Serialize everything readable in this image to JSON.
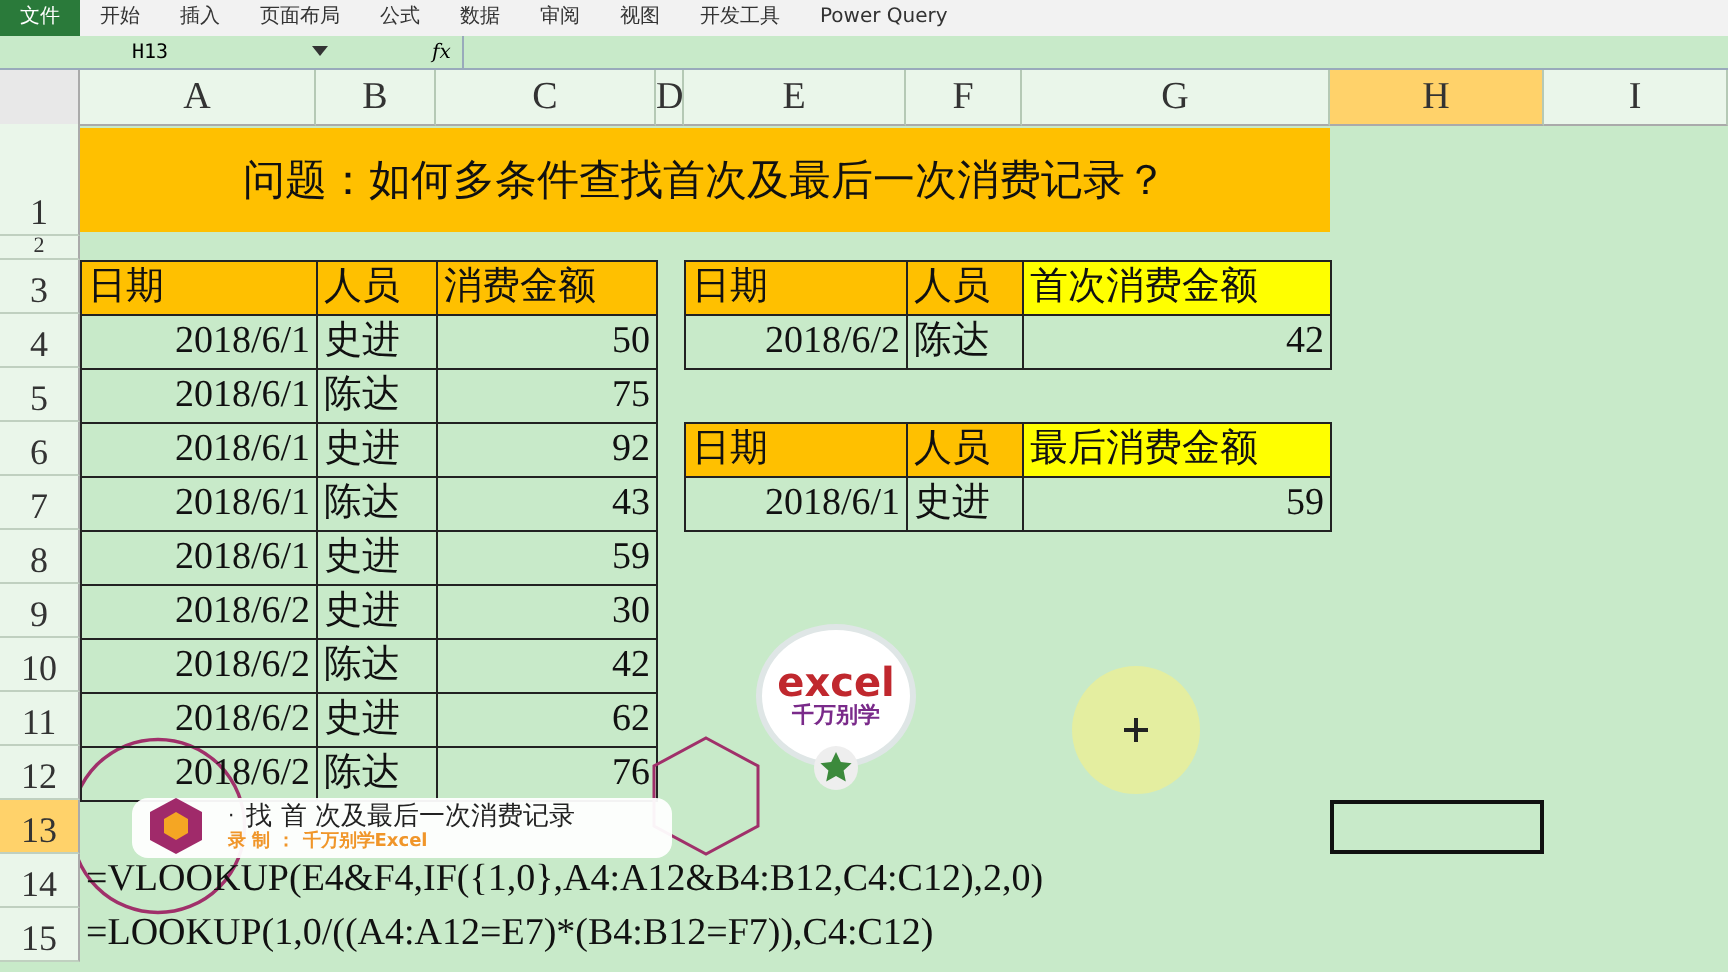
{
  "ribbon": {
    "tabs": [
      {
        "label": "文件",
        "selected": true
      },
      {
        "label": "开始",
        "selected": false
      },
      {
        "label": "插入",
        "selected": false
      },
      {
        "label": "页面布局",
        "selected": false
      },
      {
        "label": "公式",
        "selected": false
      },
      {
        "label": "数据",
        "selected": false
      },
      {
        "label": "审阅",
        "selected": false
      },
      {
        "label": "视图",
        "selected": false
      },
      {
        "label": "开发工具",
        "selected": false
      },
      {
        "label": "Power Query",
        "selected": false
      }
    ]
  },
  "formula_bar": {
    "name_box": "H13",
    "fx": "fx"
  },
  "columns": [
    {
      "label": "A",
      "selected": false
    },
    {
      "label": "B",
      "selected": false
    },
    {
      "label": "C",
      "selected": false
    },
    {
      "label": "D",
      "selected": false
    },
    {
      "label": "E",
      "selected": false
    },
    {
      "label": "F",
      "selected": false
    },
    {
      "label": "G",
      "selected": false
    },
    {
      "label": "H",
      "selected": true
    },
    {
      "label": "I",
      "selected": false
    }
  ],
  "rows": [
    {
      "number": "1",
      "selected": false,
      "kind": "tall",
      "cells": [
        {
          "kind": "title",
          "text": "问题：如何多条件查找首次及最后一次消费记录？"
        }
      ]
    },
    {
      "number": "2",
      "selected": false,
      "kind": "short",
      "cells": []
    },
    {
      "number": "3",
      "selected": false,
      "kind": "normal",
      "cells": [
        {
          "kind": "header",
          "text": "日期"
        },
        {
          "kind": "header",
          "text": "人员"
        },
        {
          "kind": "header",
          "text": "消费金额"
        },
        {
          "kind": "empty"
        },
        {
          "kind": "header",
          "text": "日期"
        },
        {
          "kind": "header",
          "text": "人员"
        },
        {
          "kind": "highlight",
          "text": "首次消费金额"
        }
      ]
    },
    {
      "number": "4",
      "selected": false,
      "kind": "normal",
      "cells": [
        {
          "kind": "number",
          "text": "2018/6/1"
        },
        {
          "kind": "text",
          "text": "史进"
        },
        {
          "kind": "number",
          "text": "50"
        },
        {
          "kind": "empty"
        },
        {
          "kind": "number",
          "text": "2018/6/2"
        },
        {
          "kind": "text",
          "text": "陈达"
        },
        {
          "kind": "number",
          "text": "42"
        }
      ]
    },
    {
      "number": "5",
      "selected": false,
      "kind": "normal",
      "cells": [
        {
          "kind": "number",
          "text": "2018/6/1"
        },
        {
          "kind": "text",
          "text": "陈达"
        },
        {
          "kind": "number",
          "text": "75"
        }
      ]
    },
    {
      "number": "6",
      "selected": false,
      "kind": "normal",
      "cells": [
        {
          "kind": "number",
          "text": "2018/6/1"
        },
        {
          "kind": "text",
          "text": "史进"
        },
        {
          "kind": "number",
          "text": "92"
        },
        {
          "kind": "empty"
        },
        {
          "kind": "header",
          "text": "日期"
        },
        {
          "kind": "header",
          "text": "人员"
        },
        {
          "kind": "highlight",
          "text": "最后消费金额"
        }
      ]
    },
    {
      "number": "7",
      "selected": false,
      "kind": "normal",
      "cells": [
        {
          "kind": "number",
          "text": "2018/6/1"
        },
        {
          "kind": "text",
          "text": "陈达"
        },
        {
          "kind": "number",
          "text": "43"
        },
        {
          "kind": "empty"
        },
        {
          "kind": "number",
          "text": "2018/6/1"
        },
        {
          "kind": "text",
          "text": "史进"
        },
        {
          "kind": "number",
          "text": "59"
        }
      ]
    },
    {
      "number": "8",
      "selected": false,
      "kind": "normal",
      "cells": [
        {
          "kind": "number",
          "text": "2018/6/1"
        },
        {
          "kind": "text",
          "text": "史进"
        },
        {
          "kind": "number",
          "text": "59"
        }
      ]
    },
    {
      "number": "9",
      "selected": false,
      "kind": "normal",
      "cells": [
        {
          "kind": "number",
          "text": "2018/6/2"
        },
        {
          "kind": "text",
          "text": "史进"
        },
        {
          "kind": "number",
          "text": "30"
        }
      ]
    },
    {
      "number": "10",
      "selected": false,
      "kind": "normal",
      "cells": [
        {
          "kind": "number",
          "text": "2018/6/2"
        },
        {
          "kind": "text",
          "text": "陈达"
        },
        {
          "kind": "number",
          "text": "42"
        }
      ]
    },
    {
      "number": "11",
      "selected": false,
      "kind": "normal",
      "cells": [
        {
          "kind": "number",
          "text": "2018/6/2"
        },
        {
          "kind": "text",
          "text": "史进"
        },
        {
          "kind": "number",
          "text": "62"
        }
      ]
    },
    {
      "number": "12",
      "selected": false,
      "kind": "normal",
      "cells": [
        {
          "kind": "number",
          "text": "2018/6/2"
        },
        {
          "kind": "text",
          "text": "陈达"
        },
        {
          "kind": "number",
          "text": "76"
        }
      ]
    },
    {
      "number": "13",
      "selected": true,
      "kind": "normal",
      "cells": [
        {
          "kind": "empty"
        },
        {
          "kind": "empty"
        },
        {
          "kind": "empty"
        },
        {
          "kind": "empty"
        },
        {
          "kind": "empty"
        },
        {
          "kind": "empty"
        },
        {
          "kind": "empty"
        },
        {
          "kind": "cursor"
        }
      ]
    },
    {
      "number": "14",
      "selected": false,
      "kind": "normal",
      "cells": [
        {
          "kind": "formula",
          "text": "=VLOOKUP(E4&F4,IF({1,0},A4:A12&B4:B12,C4:C12),2,0)"
        }
      ]
    },
    {
      "number": "15",
      "selected": false,
      "kind": "normal",
      "cells": [
        {
          "kind": "formula",
          "text": "=LOOKUP(1,0/((A4:A12=E7)*(B4:B12=F7)),C4:C12)"
        }
      ]
    }
  ],
  "logo": {
    "word": "excel",
    "subtitle": "千万别学"
  },
  "banner": {
    "bullet": "·",
    "title": "找 首 次及最后一次消费记录",
    "credit_label": "录 制 ：",
    "credit": "千万别学Excel"
  }
}
